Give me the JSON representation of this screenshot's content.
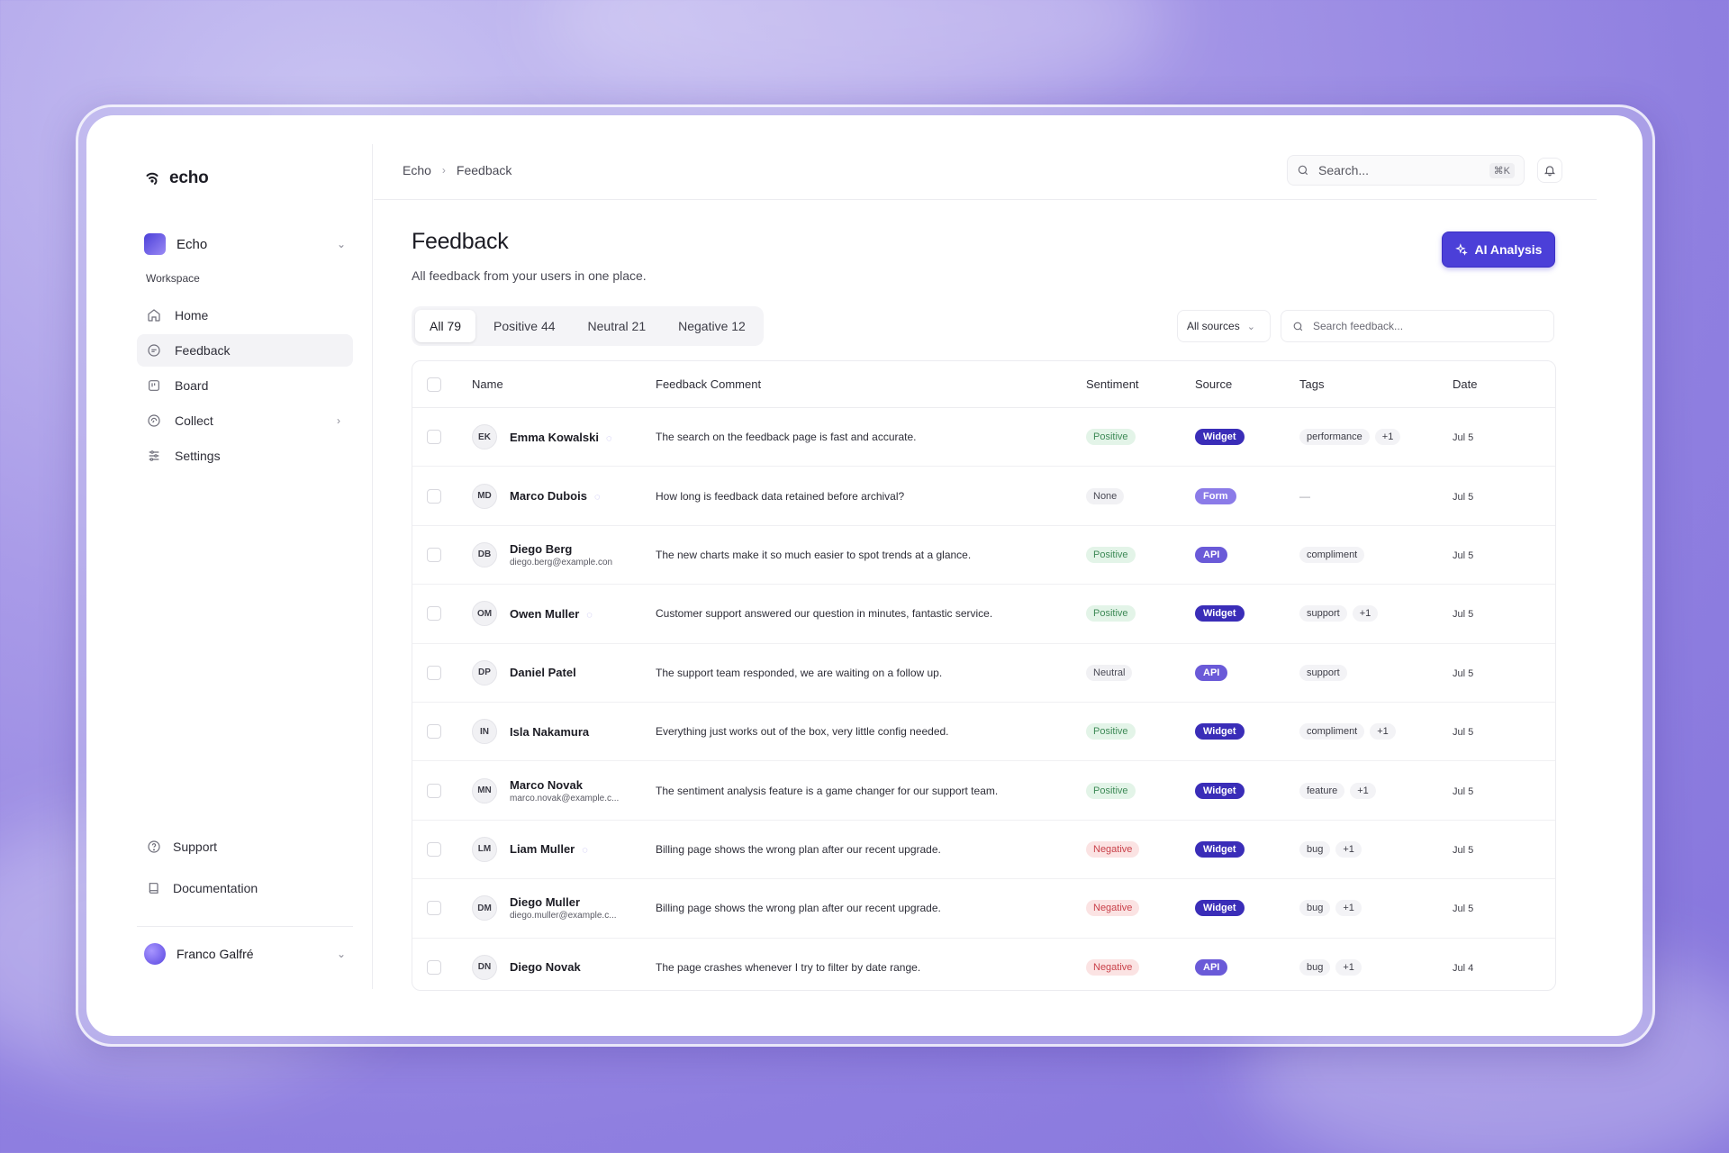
{
  "app": {
    "name": "echo"
  },
  "workspace": {
    "name": "Echo",
    "section_label": "Workspace"
  },
  "sidebar": {
    "items": [
      {
        "label": "Home",
        "icon": "home-icon",
        "active": false
      },
      {
        "label": "Feedback",
        "icon": "message-icon",
        "active": true
      },
      {
        "label": "Board",
        "icon": "board-icon",
        "active": false
      },
      {
        "label": "Collect",
        "icon": "collect-icon",
        "active": false
      },
      {
        "label": "Settings",
        "icon": "sliders-icon",
        "active": false
      }
    ],
    "bottom": [
      {
        "label": "Support",
        "icon": "help-icon"
      },
      {
        "label": "Documentation",
        "icon": "book-icon"
      }
    ],
    "user": {
      "name": "Franco Galfré"
    }
  },
  "topbar": {
    "breadcrumb": [
      "Echo",
      "Feedback"
    ],
    "search_placeholder": "Search...",
    "search_shortcut": "⌘K"
  },
  "main": {
    "title": "Feedback",
    "subtitle": "All feedback from your users in one place.",
    "ai_button": "AI Analysis",
    "tabs": [
      {
        "label": "All 79",
        "active": true
      },
      {
        "label": "Positive 44",
        "active": false
      },
      {
        "label": "Neutral 21",
        "active": false
      },
      {
        "label": "Negative 12",
        "active": false
      }
    ],
    "source_filter": "All sources",
    "feedback_search_placeholder": "Search feedback..."
  },
  "table": {
    "columns": [
      "Name",
      "Feedback Comment",
      "Sentiment",
      "Source",
      "Tags",
      "Date"
    ],
    "rows": [
      {
        "initials": "EK",
        "name": "Emma Kowalski",
        "email": "",
        "chat": true,
        "comment": "The search on the feedback page is fast and accurate.",
        "sentiment": "Positive",
        "source": "Widget",
        "tags": [
          "performance",
          "+1"
        ],
        "date": "Jul 5"
      },
      {
        "initials": "MD",
        "name": "Marco Dubois",
        "email": "",
        "chat": true,
        "comment": "How long is feedback data retained before archival?",
        "sentiment": "None",
        "source": "Form",
        "tags": [],
        "date": "Jul 5"
      },
      {
        "initials": "DB",
        "name": "Diego Berg",
        "email": "diego.berg@example.con",
        "chat": false,
        "comment": "The new charts make it so much easier to spot trends at a glance.",
        "sentiment": "Positive",
        "source": "API",
        "tags": [
          "compliment"
        ],
        "date": "Jul 5"
      },
      {
        "initials": "OM",
        "name": "Owen Muller",
        "email": "",
        "chat": true,
        "comment": "Customer support answered our question in minutes, fantastic service.",
        "sentiment": "Positive",
        "source": "Widget",
        "tags": [
          "support",
          "+1"
        ],
        "date": "Jul 5"
      },
      {
        "initials": "DP",
        "name": "Daniel Patel",
        "email": "",
        "chat": false,
        "comment": "The support team responded, we are waiting on a follow up.",
        "sentiment": "Neutral",
        "source": "API",
        "tags": [
          "support"
        ],
        "date": "Jul 5"
      },
      {
        "initials": "IN",
        "name": "Isla Nakamura",
        "email": "",
        "chat": false,
        "comment": "Everything just works out of the box, very little config needed.",
        "sentiment": "Positive",
        "source": "Widget",
        "tags": [
          "compliment",
          "+1"
        ],
        "date": "Jul 5"
      },
      {
        "initials": "MN",
        "name": "Marco Novak",
        "email": "marco.novak@example.c...",
        "chat": false,
        "comment": "The sentiment analysis feature is a game changer for our support team.",
        "sentiment": "Positive",
        "source": "Widget",
        "tags": [
          "feature",
          "+1"
        ],
        "date": "Jul 5"
      },
      {
        "initials": "LM",
        "name": "Liam Muller",
        "email": "",
        "chat": true,
        "comment": "Billing page shows the wrong plan after our recent upgrade.",
        "sentiment": "Negative",
        "source": "Widget",
        "tags": [
          "bug",
          "+1"
        ],
        "date": "Jul 5"
      },
      {
        "initials": "DM",
        "name": "Diego Muller",
        "email": "diego.muller@example.c...",
        "chat": false,
        "comment": "Billing page shows the wrong plan after our recent upgrade.",
        "sentiment": "Negative",
        "source": "Widget",
        "tags": [
          "bug",
          "+1"
        ],
        "date": "Jul 5"
      },
      {
        "initials": "DN",
        "name": "Diego Novak",
        "email": "",
        "chat": false,
        "comment": "The page crashes whenever I try to filter by date range.",
        "sentiment": "Negative",
        "source": "API",
        "tags": [
          "bug",
          "+1"
        ],
        "date": "Jul 4"
      }
    ],
    "empty_tag": "—"
  },
  "colors": {
    "accent": "#4b3fd8",
    "widget": "#3a2db8",
    "form": "#8b7be8",
    "api": "#6a5ad8"
  }
}
